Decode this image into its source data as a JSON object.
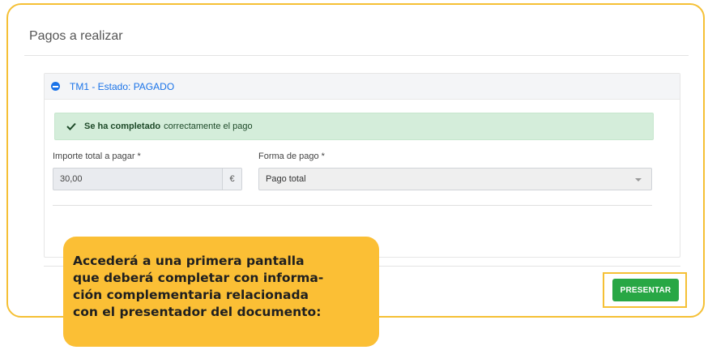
{
  "page": {
    "title": "Pagos a realizar"
  },
  "panel": {
    "title": "TM1 - Estado: PAGADO",
    "alert": {
      "bold_text": "Se ha completado",
      "rest_text": "correctamente el pago",
      "icon": "check-icon"
    },
    "amount_field": {
      "label": "Importe total a pagar *",
      "value": "30,00",
      "addon": "€"
    },
    "payment_method": {
      "label": "Forma de pago *",
      "selected": "Pago total"
    }
  },
  "actions": {
    "present_label": "PRESENTAR"
  },
  "callout": {
    "lines": [
      "Accederá a una primera pantalla",
      "que deberá completar con informa-",
      "ción complementaria relacionada",
      "con el presentador del documento:"
    ]
  },
  "colors": {
    "highlight": "#f5c035",
    "callout_bg": "#fbbf35",
    "success": "#28a745",
    "alert_bg": "#d4edda",
    "link_blue": "#1a73e8"
  }
}
